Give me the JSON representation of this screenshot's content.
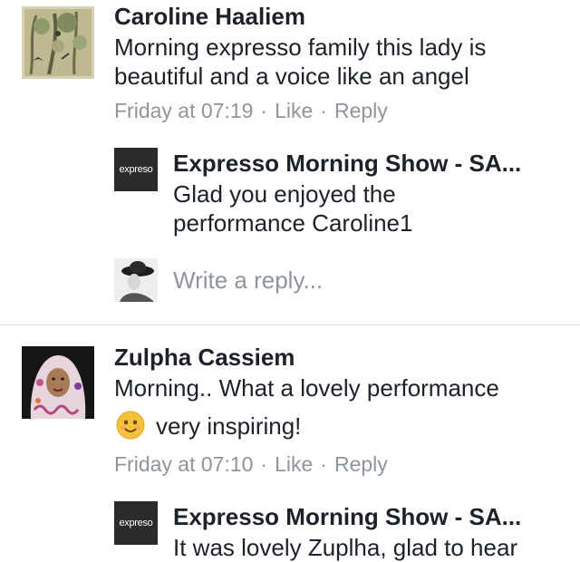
{
  "comments": [
    {
      "author": "Caroline Haaliem",
      "text_line1": "Morning expresso family this lady is",
      "text_line2": "beautiful and a voice like an angel",
      "time": "Friday at 07:19",
      "like_label": "Like",
      "reply_label": "Reply",
      "page_reply": {
        "author": "Expresso Morning Show - SA...",
        "text_line1": "Glad you enjoyed the",
        "text_line2": "performance Caroline1",
        "logo_text": "expreso"
      },
      "reply_placeholder": "Write a reply..."
    },
    {
      "author": "Zulpha Cassiem",
      "text_line1": "Morning.. What a lovely performance",
      "emoji": "smiling-face-emoji",
      "text_line2": "very inspiring!",
      "time": "Friday at 07:10",
      "like_label": "Like",
      "reply_label": "Reply",
      "page_reply": {
        "author": "Expresso Morning Show - SA...",
        "text_line1": "It was lovely Zuplha, glad to hear",
        "logo_text": "expreso"
      }
    }
  ],
  "separator": "·"
}
